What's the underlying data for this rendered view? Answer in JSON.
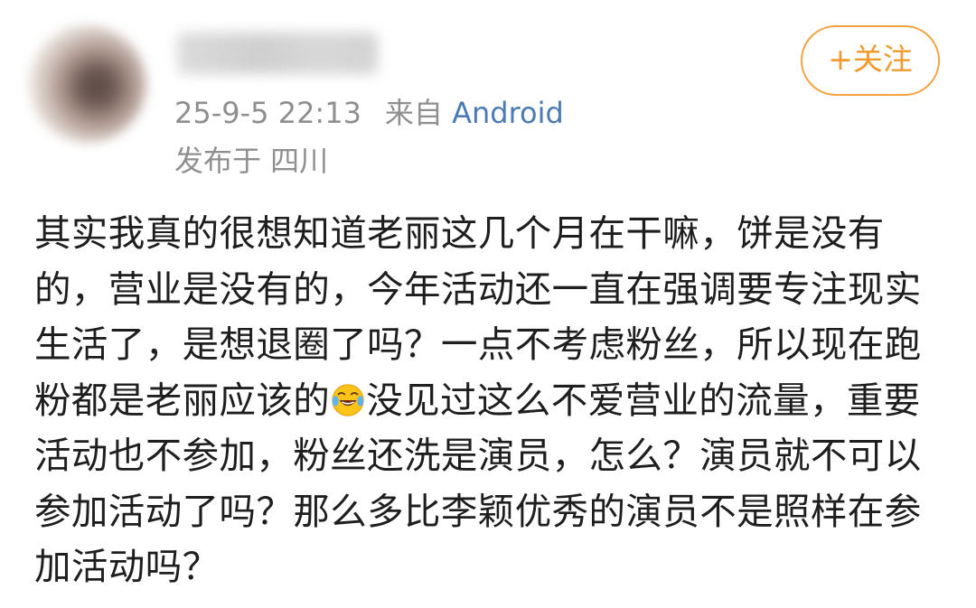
{
  "post": {
    "username": "",
    "timestamp": "25-9-5 22:13",
    "source_prefix": "来自",
    "source_name": "Android",
    "location_label": "发布于 四川",
    "follow_label": "+关注",
    "content_part1": "其实我真的很想知道老丽这几个月在干嘛，饼是没有的，营业是没有的，今年活动还一直在强调要专注现实生活了，是想退圈了吗？一点不考虑粉丝，所以现在跑粉都是老丽应该的",
    "emoji_icon": "laughing-crying-emoji-icon",
    "content_part2": "没见过这么不爱营业的流量，重要活动也不参加，粉丝还洗是演员，怎么？演员就不可以参加活动了吗？那么多比李颖优秀的演员不是照样在参加活动吗？"
  },
  "colors": {
    "follow_accent": "#f09a2e",
    "source_link": "#4b7bb4",
    "meta_text": "#8f8f8f",
    "body_text": "#1e1e1e"
  }
}
